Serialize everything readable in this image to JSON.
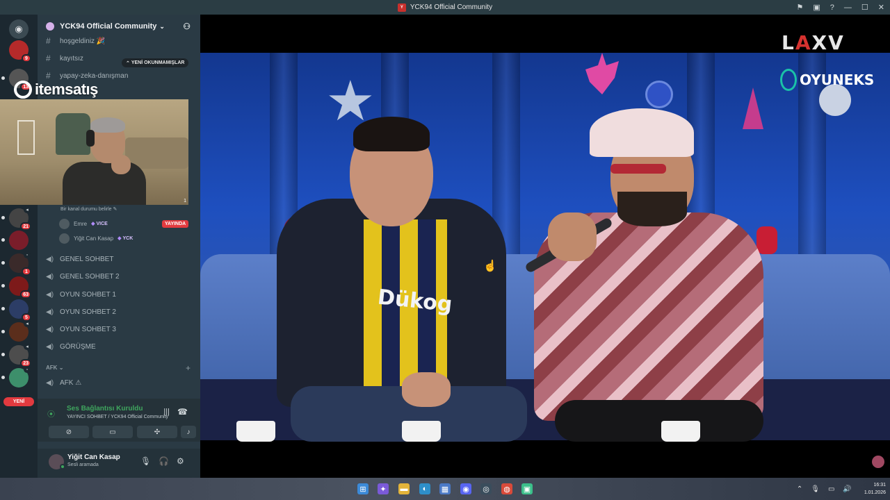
{
  "window": {
    "title": "YCK94 Official Community"
  },
  "server": {
    "name": "YCK94 Official Community",
    "unread_pill": "YENİ OKUNMAMIŞLAR",
    "text_channels": [
      "hoşgeldiniz 🎉",
      "kayıtsız",
      "yapay-zeka-danışman"
    ],
    "status_line": "Bir kanal durumu belirle",
    "voice_users": [
      {
        "name": "Emre",
        "tag": "VICE"
      },
      {
        "name": "Yiğit Can Kasap",
        "tag": "YCK"
      }
    ],
    "live_label": "YAYINDA",
    "voice_channels": [
      "GENEL SOHBET",
      "GENEL SOHBET 2",
      "OYUN SOHBET 1",
      "OYUN SOHBET 2",
      "OYUN SOHBET 3",
      "GÖRÜŞME"
    ],
    "afk_category": "AFK",
    "afk_channel": "AFK ⚠"
  },
  "rail": {
    "badges": [
      "9",
      "13",
      "21",
      "1",
      "63",
      "5",
      "23"
    ],
    "new_label": "YENİ"
  },
  "overlay": {
    "itemsatis": "itemsatış",
    "webcam_index": "1",
    "laxv": [
      "L",
      "A",
      "XV"
    ],
    "oyuneks": "OYUNEKS",
    "shirt_text": "Dükog"
  },
  "voice_panel": {
    "status": "Ses Bağlantısı Kuruldu",
    "subtitle": "YAYINCI SOHBET / YCK94 Official Community"
  },
  "user_panel": {
    "name": "Yiğit Can Kasap",
    "status": "Sesli aramada"
  },
  "taskbar": {
    "time": "16:31",
    "date": "1.01.2026"
  },
  "colors": {
    "accent_green": "#3fa65e",
    "live_red": "#e23a3f",
    "sidebar_bg": "#2a3a44"
  }
}
